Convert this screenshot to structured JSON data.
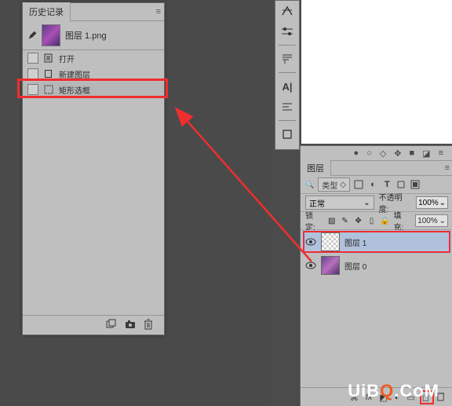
{
  "history": {
    "title": "历史记录",
    "doc_name": "图层 1.png",
    "items": [
      {
        "label": "打开",
        "icon": "doc"
      },
      {
        "label": "新建图层",
        "icon": "doc"
      },
      {
        "label": "矩形选框",
        "icon": "marquee"
      }
    ]
  },
  "layers": {
    "title": "图层",
    "kind_label": "类型",
    "blend_mode": "正常",
    "opacity_label": "不透明度:",
    "opacity_value": "100%",
    "lock_label": "锁定:",
    "fill_label": "填充:",
    "fill_value": "100%",
    "items": [
      {
        "name": "图层 1",
        "thumb": "checker",
        "selected": true
      },
      {
        "name": "图层 0",
        "thumb": "image",
        "selected": false
      }
    ]
  },
  "watermark": {
    "left": "UiB",
    "q": "Q",
    "right": ".CoM"
  }
}
